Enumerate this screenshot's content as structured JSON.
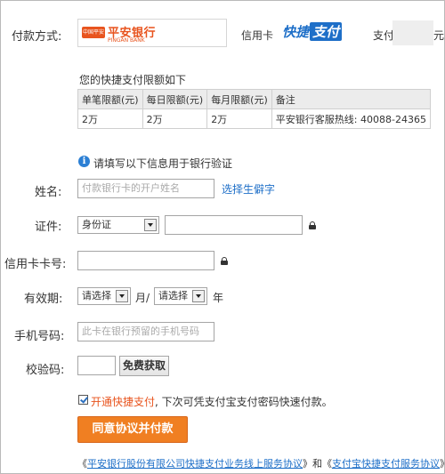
{
  "payment": {
    "label": "付款方式:",
    "bank_mark": "中国平安",
    "bank_name": "平安银行",
    "bank_name_en": "PINGAN BANK",
    "card_type": "信用卡",
    "kuaijie_part1": "快捷",
    "kuaijie_part2": "支付",
    "pay_label": "支付",
    "pay_tail": "元"
  },
  "limits": {
    "title": "您的快捷支付限额如下",
    "headers": [
      "单笔限额(元)",
      "每日限额(元)",
      "每月限额(元)",
      "备注"
    ],
    "row": [
      "2万",
      "2万",
      "2万",
      "平安银行客服热线: 40088-24365"
    ]
  },
  "info": {
    "icon": "info-icon",
    "text": "请填写以下信息用于银行验证"
  },
  "form": {
    "name_label": "姓名:",
    "name_placeholder": "付款银行卡的开户姓名",
    "rare_char_link": "选择生僻字",
    "id_label": "证件:",
    "id_type": "身份证",
    "card_label": "信用卡卡号:",
    "expiry_label": "有效期:",
    "month_select": "请选择",
    "month_unit": "月/",
    "year_select": "请选择",
    "year_unit": "年",
    "phone_label": "手机号码:",
    "phone_placeholder": "此卡在银行预留的手机号码",
    "code_label": "校验码:",
    "code_button": "免费获取"
  },
  "enable": {
    "checked": true,
    "highlight": "开通快捷支付",
    "rest": ", 下次可凭支付宝支付密码快速付款。"
  },
  "submit_label": "同意协议并付款",
  "agreements": {
    "open1": "《",
    "link1": "平安银行股份有限公司快捷支付业务线上服务协议",
    "mid": "》和《",
    "link2": "支付宝快捷支付服务协议",
    "close": "》"
  },
  "colors": {
    "accent_orange": "#f07f22",
    "link_blue": "#1e6fc8",
    "bank_orange": "#e8541e"
  }
}
